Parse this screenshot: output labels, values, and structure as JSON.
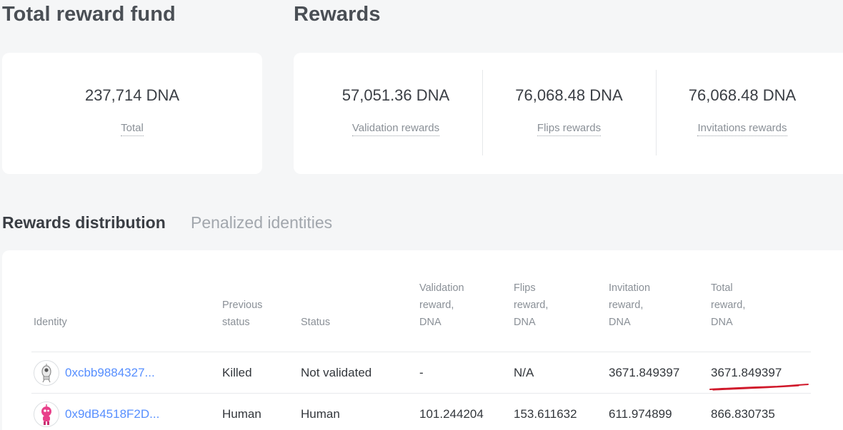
{
  "total_fund": {
    "heading": "Total reward fund",
    "value": "237,714 DNA",
    "label": "Total"
  },
  "rewards": {
    "heading": "Rewards",
    "items": [
      {
        "value": "57,051.36 DNA",
        "label": "Validation rewards"
      },
      {
        "value": "76,068.48 DNA",
        "label": "Flips rewards"
      },
      {
        "value": "76,068.48 DNA",
        "label": "Invitations rewards"
      }
    ]
  },
  "tabs": [
    {
      "label": "Rewards distribution",
      "active": true
    },
    {
      "label": "Penalized identities",
      "active": false
    }
  ],
  "table": {
    "headers": {
      "identity": [
        "Identity"
      ],
      "previous_status": [
        "Previous",
        "status"
      ],
      "status": [
        "Status"
      ],
      "validation_reward": [
        "Validation",
        "reward,",
        "DNA"
      ],
      "flips_reward": [
        "Flips",
        "reward,",
        "DNA"
      ],
      "invitation_reward": [
        "Invitation",
        "reward,",
        "DNA"
      ],
      "total_reward": [
        "Total",
        "reward,",
        "DNA"
      ]
    },
    "rows": [
      {
        "identity": "0xcbb9884327...",
        "previous_status": "Killed",
        "status": "Not validated",
        "validation_reward": "-",
        "flips_reward": "N/A",
        "invitation_reward": "3671.849397",
        "total_reward": "3671.849397",
        "avatar_icon": "robot-avatar-gray"
      },
      {
        "identity": "0x9dB4518F2D...",
        "previous_status": "Human",
        "status": "Human",
        "validation_reward": "101.244204",
        "flips_reward": "153.611632",
        "invitation_reward": "611.974899",
        "total_reward": "866.830735",
        "avatar_icon": "robot-avatar-pink"
      }
    ]
  },
  "colors": {
    "link": "#578fff",
    "annotation": "#d0182a",
    "avatar_pink": "#e8408a"
  }
}
